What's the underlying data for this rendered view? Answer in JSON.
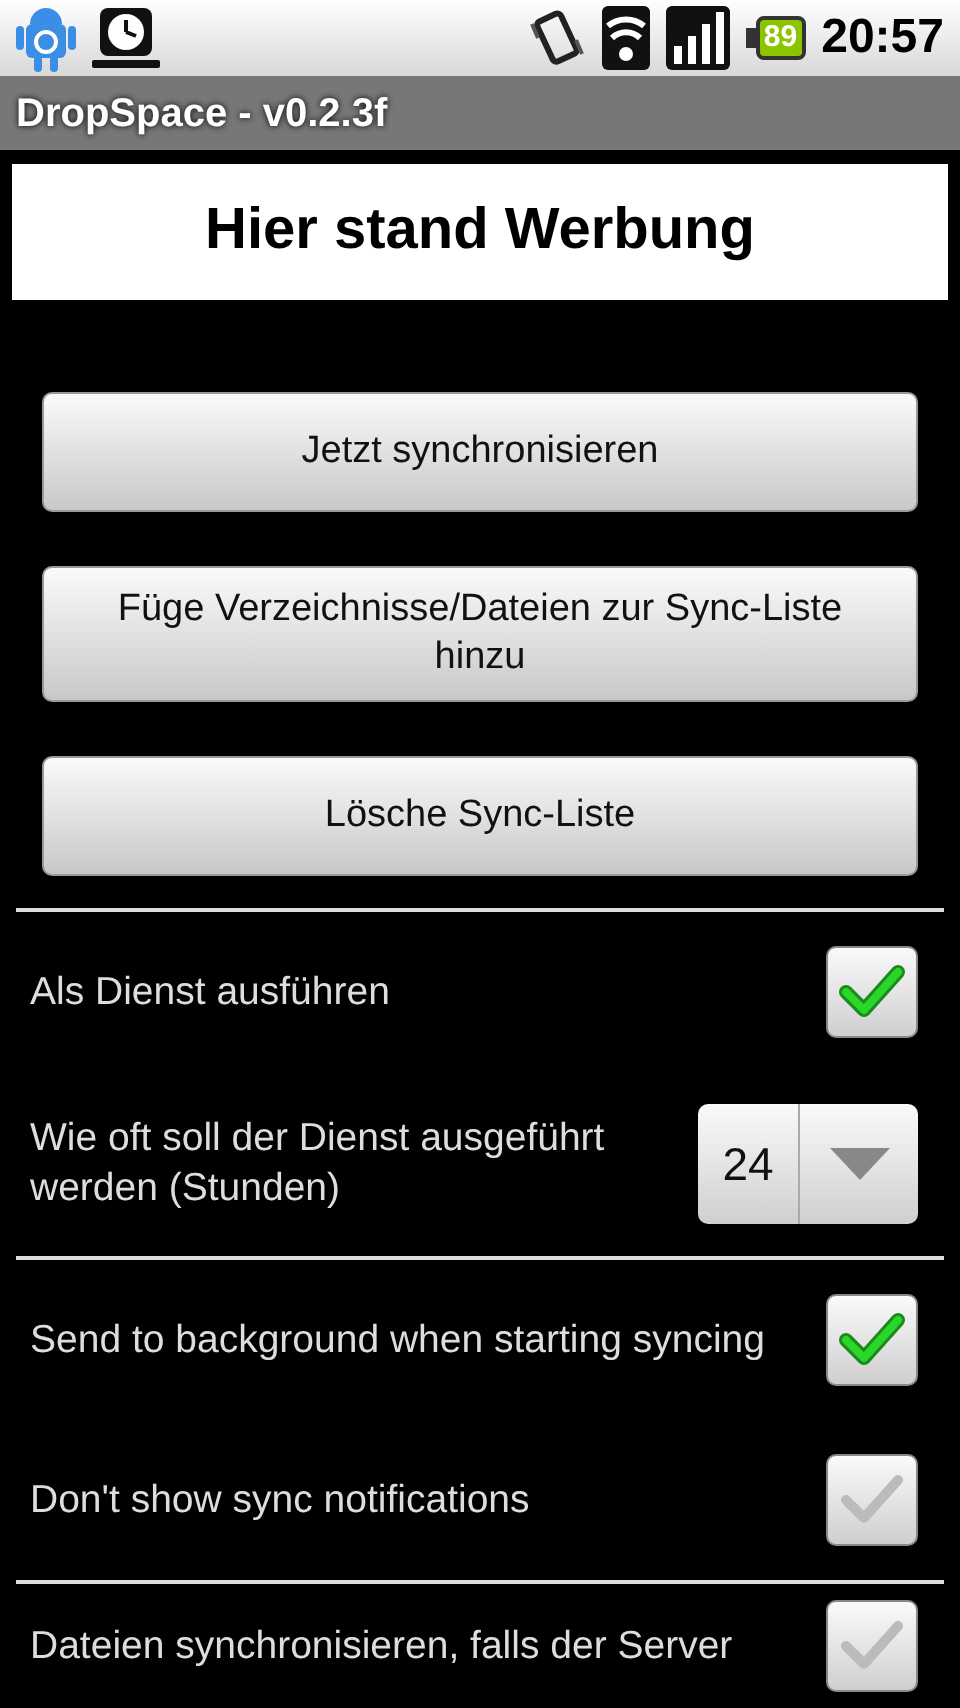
{
  "status_bar": {
    "battery": "89",
    "time": "20:57"
  },
  "window": {
    "title": "DropSpace - v0.2.3f"
  },
  "ad_banner": "Hier stand Werbung",
  "buttons": [
    "Jetzt synchronisieren",
    "Füge Verzeichnisse/Dateien zur Sync-Liste hinzu",
    "Lösche Sync-Liste"
  ],
  "setting_groups": [
    [
      {
        "kind": "checkbox",
        "label": "Als Dienst ausführen",
        "checked": true
      },
      {
        "kind": "spinner",
        "label": "Wie oft soll der Dienst ausgeführt werden (Stunden)",
        "value": "24"
      }
    ],
    [
      {
        "kind": "checkbox",
        "label": "Send to background when starting syncing",
        "checked": true
      },
      {
        "kind": "checkbox",
        "label": "Don't show sync notifications",
        "checked": false
      }
    ],
    [
      {
        "kind": "checkbox",
        "label": "Dateien synchronisieren, falls der Server",
        "checked": false
      }
    ]
  ]
}
